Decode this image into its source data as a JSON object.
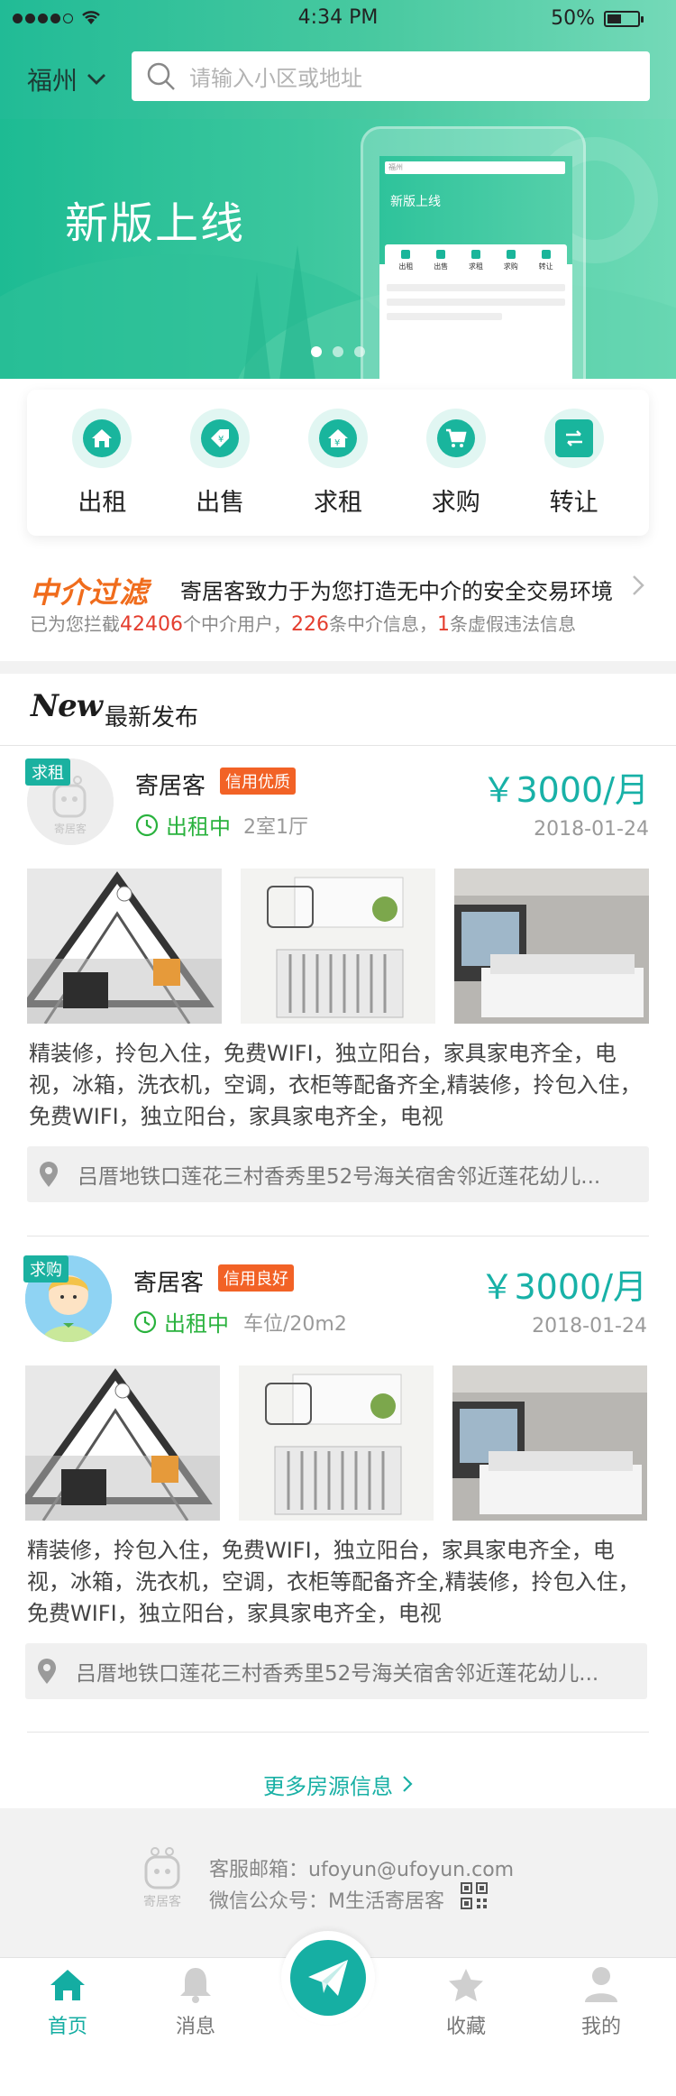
{
  "status_bar": {
    "time": "4:34 PM",
    "battery": "50%"
  },
  "header": {
    "city": "福州",
    "search_placeholder": "请输入小区或地址"
  },
  "banner": {
    "title": "新版上线",
    "mock_screen": {
      "search": "福州",
      "title": "新版上线",
      "icons": [
        "出租",
        "出售",
        "求租",
        "求购",
        "转让"
      ]
    },
    "dots_total": 3,
    "dots_active": 0
  },
  "categories": [
    {
      "label": "出租",
      "icon": "house-icon"
    },
    {
      "label": "出售",
      "icon": "price-tag-icon"
    },
    {
      "label": "求租",
      "icon": "house-yen-icon"
    },
    {
      "label": "求购",
      "icon": "cart-icon"
    },
    {
      "label": "转让",
      "icon": "transfer-icon"
    }
  ],
  "filter": {
    "logo": "中介过滤",
    "slogan": "寄居客致力于为您打造无中介的安全交易环境",
    "stats_prefix": "已为您拦截",
    "intercepted_users": "42406",
    "stats_mid1": "个中介用户，",
    "intercepted_info": "226",
    "stats_mid2": "条中介信息，",
    "fake_info": "1",
    "stats_suffix": "条虚假违法信息"
  },
  "latest": {
    "logo": "New",
    "title": "最新发布",
    "listings": [
      {
        "badge": "求租",
        "name": "寄居客",
        "credit": "信用优质",
        "status": "出租中",
        "room": "2室1厅",
        "price": "￥3000/月",
        "date": "2018-01-24",
        "description": "精装修，拎包入住，免费WIFI，独立阳台，家具家电齐全，电视，冰箱，洗衣机，空调，衣柜等配备齐全,精装修，拎包入住，免费WIFI，独立阳台，家具家电齐全，电视",
        "address": "吕厝地铁口莲花三村香秀里52号海关宿舍邻近莲花幼儿...",
        "avatar": "logo"
      },
      {
        "badge": "求购",
        "name": "寄居客",
        "credit": "信用良好",
        "status": "出租中",
        "room": "车位/20m2",
        "price": "￥3000/月",
        "date": "2018-01-24",
        "description": "精装修，拎包入住，免费WIFI，独立阳台，家具家电齐全，电视，冰箱，洗衣机，空调，衣柜等配备齐全,精装修，拎包入住，免费WIFI，独立阳台，家具家电齐全，电视",
        "address": "吕厝地铁口莲花三村香秀里52号海关宿舍邻近莲花幼儿...",
        "avatar": "cartoon"
      }
    ],
    "more": "更多房源信息"
  },
  "footer": {
    "logo_text": "寄居客",
    "email": "客服邮箱：ufoyun@ufoyun.com",
    "wechat": "微信公众号：M生活寄居客"
  },
  "tabbar": {
    "tabs": [
      {
        "label": "首页",
        "icon": "home-icon",
        "active": true
      },
      {
        "label": "消息",
        "icon": "bell-icon",
        "active": false
      },
      {
        "label": "收藏",
        "icon": "star-icon",
        "active": false
      },
      {
        "label": "我的",
        "icon": "user-icon",
        "active": false
      }
    ],
    "center_icon": "paper-plane-icon"
  },
  "colors": {
    "accent": "#19b0a5",
    "orange": "#f26226",
    "green": "#29b23d",
    "red": "#e43d2e"
  }
}
